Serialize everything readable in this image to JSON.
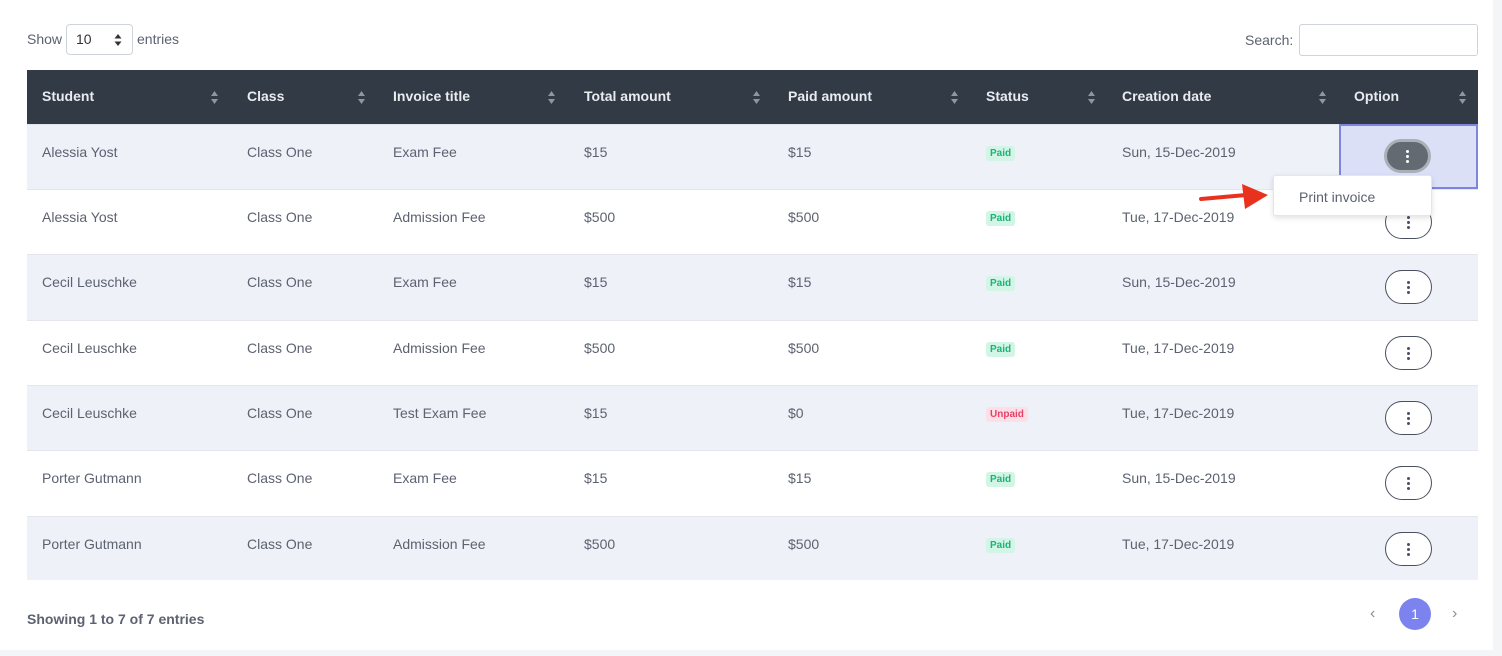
{
  "controls": {
    "show_label": "Show",
    "entries_value": "10",
    "entries_label": "entries",
    "search_label": "Search:",
    "search_value": "",
    "search_placeholder": ""
  },
  "table": {
    "columns": [
      "Student",
      "Class",
      "Invoice title",
      "Total amount",
      "Paid amount",
      "Status",
      "Creation date",
      "Option"
    ],
    "rows": [
      {
        "student": "Alessia Yost",
        "class": "Class One",
        "title": "Exam Fee",
        "total": "$15",
        "paid": "$15",
        "status": "Paid",
        "date": "Sun, 15-Dec-2019"
      },
      {
        "student": "Alessia Yost",
        "class": "Class One",
        "title": "Admission Fee",
        "total": "$500",
        "paid": "$500",
        "status": "Paid",
        "date": "Tue, 17-Dec-2019"
      },
      {
        "student": "Cecil Leuschke",
        "class": "Class One",
        "title": "Exam Fee",
        "total": "$15",
        "paid": "$15",
        "status": "Paid",
        "date": "Sun, 15-Dec-2019"
      },
      {
        "student": "Cecil Leuschke",
        "class": "Class One",
        "title": "Admission Fee",
        "total": "$500",
        "paid": "$500",
        "status": "Paid",
        "date": "Tue, 17-Dec-2019"
      },
      {
        "student": "Cecil Leuschke",
        "class": "Class One",
        "title": "Test Exam Fee",
        "total": "$15",
        "paid": "$0",
        "status": "Unpaid",
        "date": "Tue, 17-Dec-2019"
      },
      {
        "student": "Porter Gutmann",
        "class": "Class One",
        "title": "Exam Fee",
        "total": "$15",
        "paid": "$15",
        "status": "Paid",
        "date": "Sun, 15-Dec-2019"
      },
      {
        "student": "Porter Gutmann",
        "class": "Class One",
        "title": "Admission Fee",
        "total": "$500",
        "paid": "$500",
        "status": "Paid",
        "date": "Tue, 17-Dec-2019"
      }
    ]
  },
  "dropdown": {
    "print_invoice": "Print invoice"
  },
  "footer": {
    "info": "Showing 1 to 7 of 7 entries",
    "prev": "‹",
    "current_page": "1",
    "next": "›"
  },
  "icons": {
    "sort": "sort-icon",
    "options": "kebab-menu-icon",
    "arrow": "red-arrow-icon"
  },
  "colors": {
    "header_bg": "#323a46",
    "stripe": "#eef1f8",
    "paid_bg": "#d3f5e6",
    "paid_text": "#1bb377",
    "unpaid_bg": "#fde0e6",
    "unpaid_text": "#e5416b",
    "accent": "#7c83ef",
    "arrow": "#e8321e"
  }
}
